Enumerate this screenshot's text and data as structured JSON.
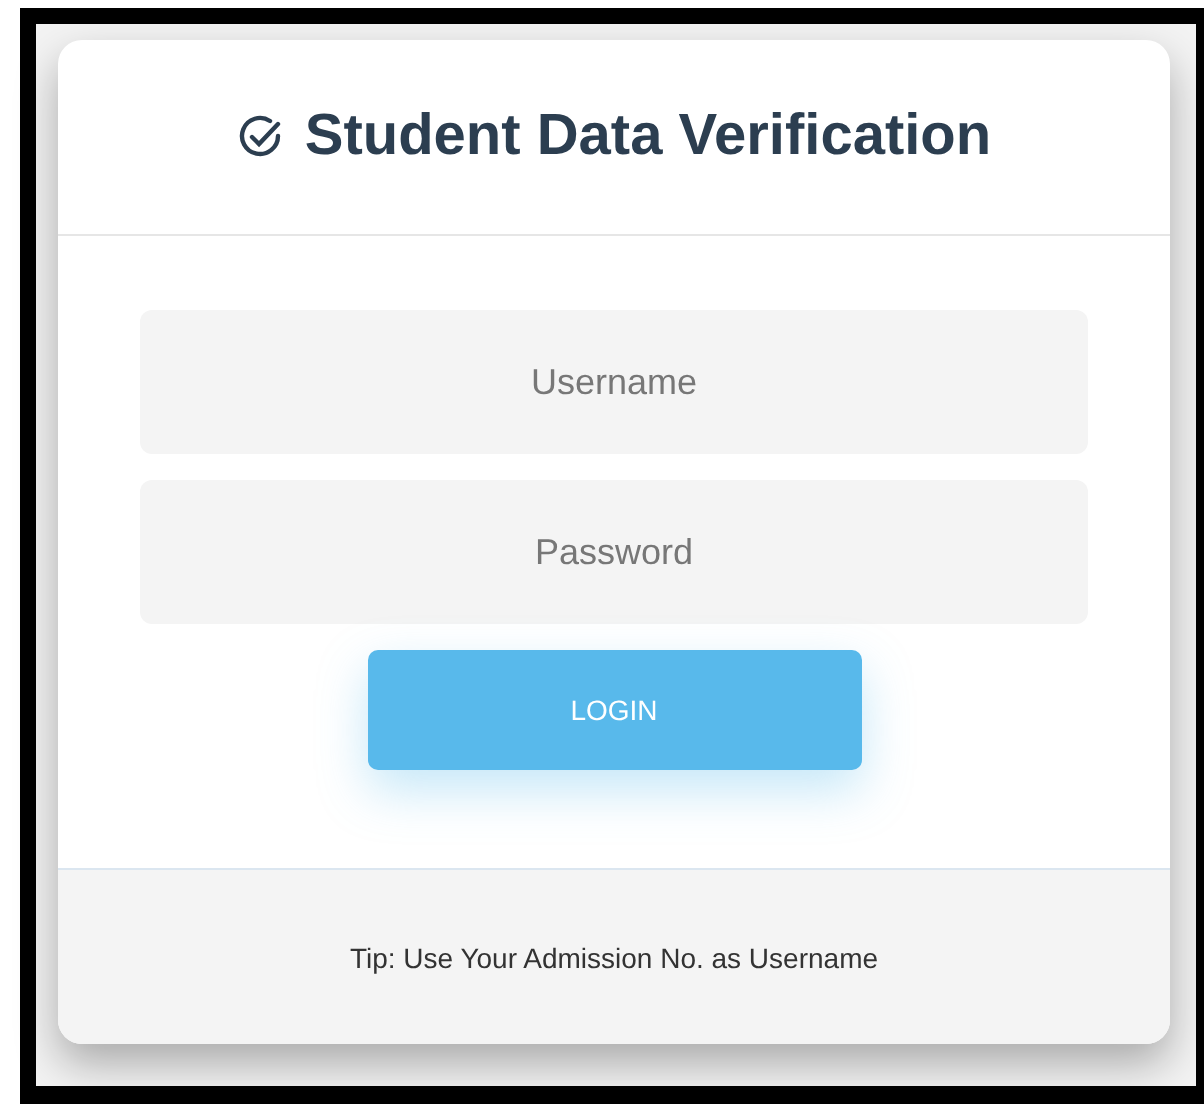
{
  "card": {
    "title": "Student Data Verification",
    "fields": [
      {
        "placeholder": "Username"
      },
      {
        "placeholder": "Password"
      }
    ],
    "button": "LOGIN",
    "tip": "Tip: Use Your Admission No. as Username"
  }
}
